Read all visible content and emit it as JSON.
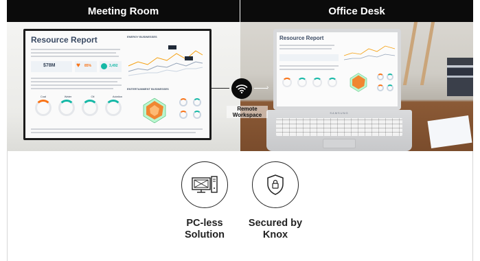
{
  "header": {
    "left_title": "Meeting Room",
    "right_title": "Office Desk"
  },
  "report": {
    "title": "Resource Report",
    "stat_value": "$78M",
    "stat_pct_1": "85%",
    "stat_pct_2": "3,492",
    "chart_caption": "ENERGY BUSINESSES",
    "lower_caption": "ENTERTAINMENT BUSINESSES",
    "gauges": [
      "Coal",
      "Water",
      "Oil",
      "Aviation"
    ]
  },
  "remote": {
    "label_line1": "Remote",
    "label_line2": "Workspace",
    "icon": "wifi-icon"
  },
  "laptop": {
    "brand": "SAMSUNG"
  },
  "features": [
    {
      "icon": "computer-tower-icon",
      "line1": "PC-less",
      "line2": "Solution"
    },
    {
      "icon": "shield-lock-icon",
      "line1": "Secured by",
      "line2": "Knox"
    }
  ],
  "colors": {
    "header_bg": "#0b0b0b",
    "header_text": "#ffffff",
    "accent_orange": "#f97316",
    "accent_teal": "#14b8a6"
  }
}
